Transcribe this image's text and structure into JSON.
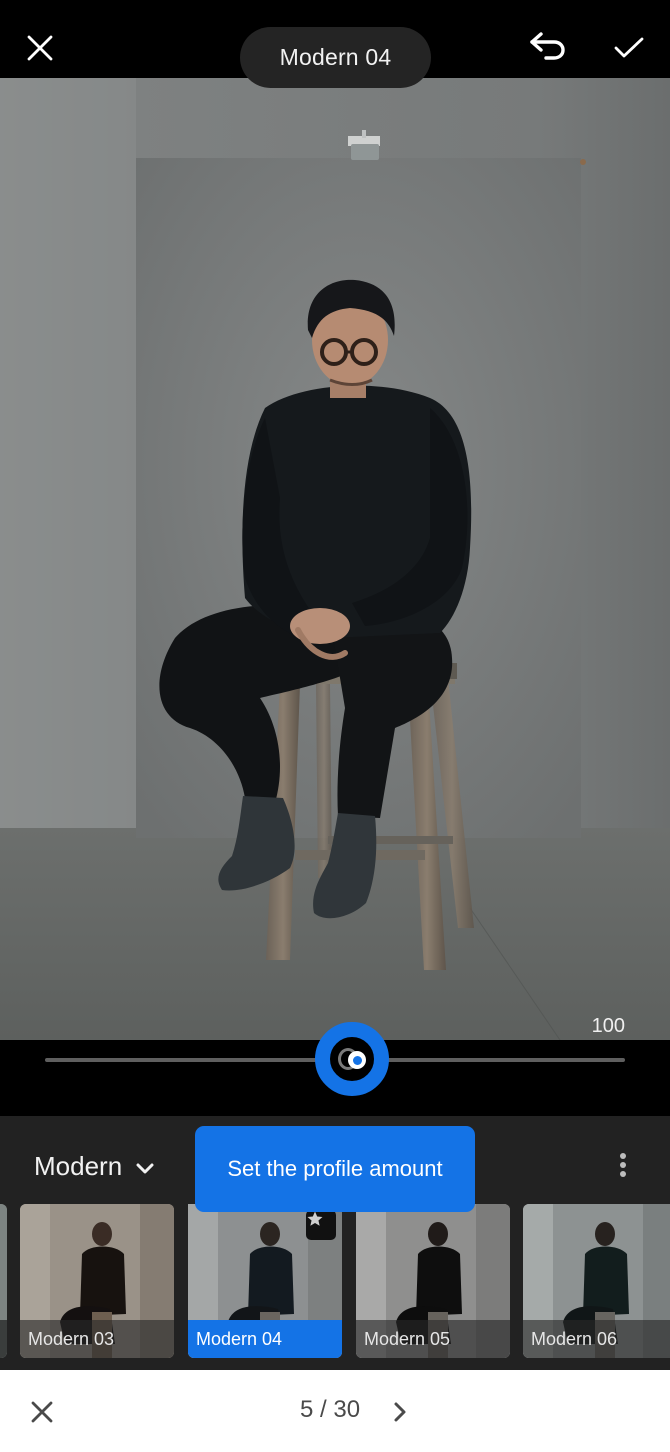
{
  "top_bar": {
    "title": "Modern 04",
    "close_icon": "close-icon",
    "undo_icon": "undo-icon",
    "done_icon": "checkmark-icon"
  },
  "editor": {
    "profile_amount": "100",
    "profile_amount_value": 100,
    "slider_position_fraction": 0.53
  },
  "profiles_panel": {
    "group_label": "Modern",
    "group_dropdown_icon": "chevron-down-icon",
    "more_icon": "more-vertical-icon",
    "coachmark_text": "Set the profile amount",
    "thumbnails": [
      {
        "label": "Modern 03",
        "selected": false,
        "favorite": false,
        "tone": "warm"
      },
      {
        "label": "Modern 04",
        "selected": true,
        "favorite": true,
        "tone": "cool"
      },
      {
        "label": "Modern 05",
        "selected": false,
        "favorite": false,
        "tone": "neutral"
      },
      {
        "label": "Modern 06",
        "selected": false,
        "favorite": false,
        "tone": "teal"
      }
    ],
    "favorite_icon": "star-icon"
  },
  "tour_nav": {
    "close_icon": "close-icon",
    "step_current": 5,
    "step_total": 30,
    "step_label": "5 / 30",
    "next_icon": "chevron-right-icon"
  },
  "colors": {
    "accent": "#1473e6",
    "panel_bg": "#222222",
    "top_bar_bg": "#000000",
    "pill_bg": "#242424"
  }
}
